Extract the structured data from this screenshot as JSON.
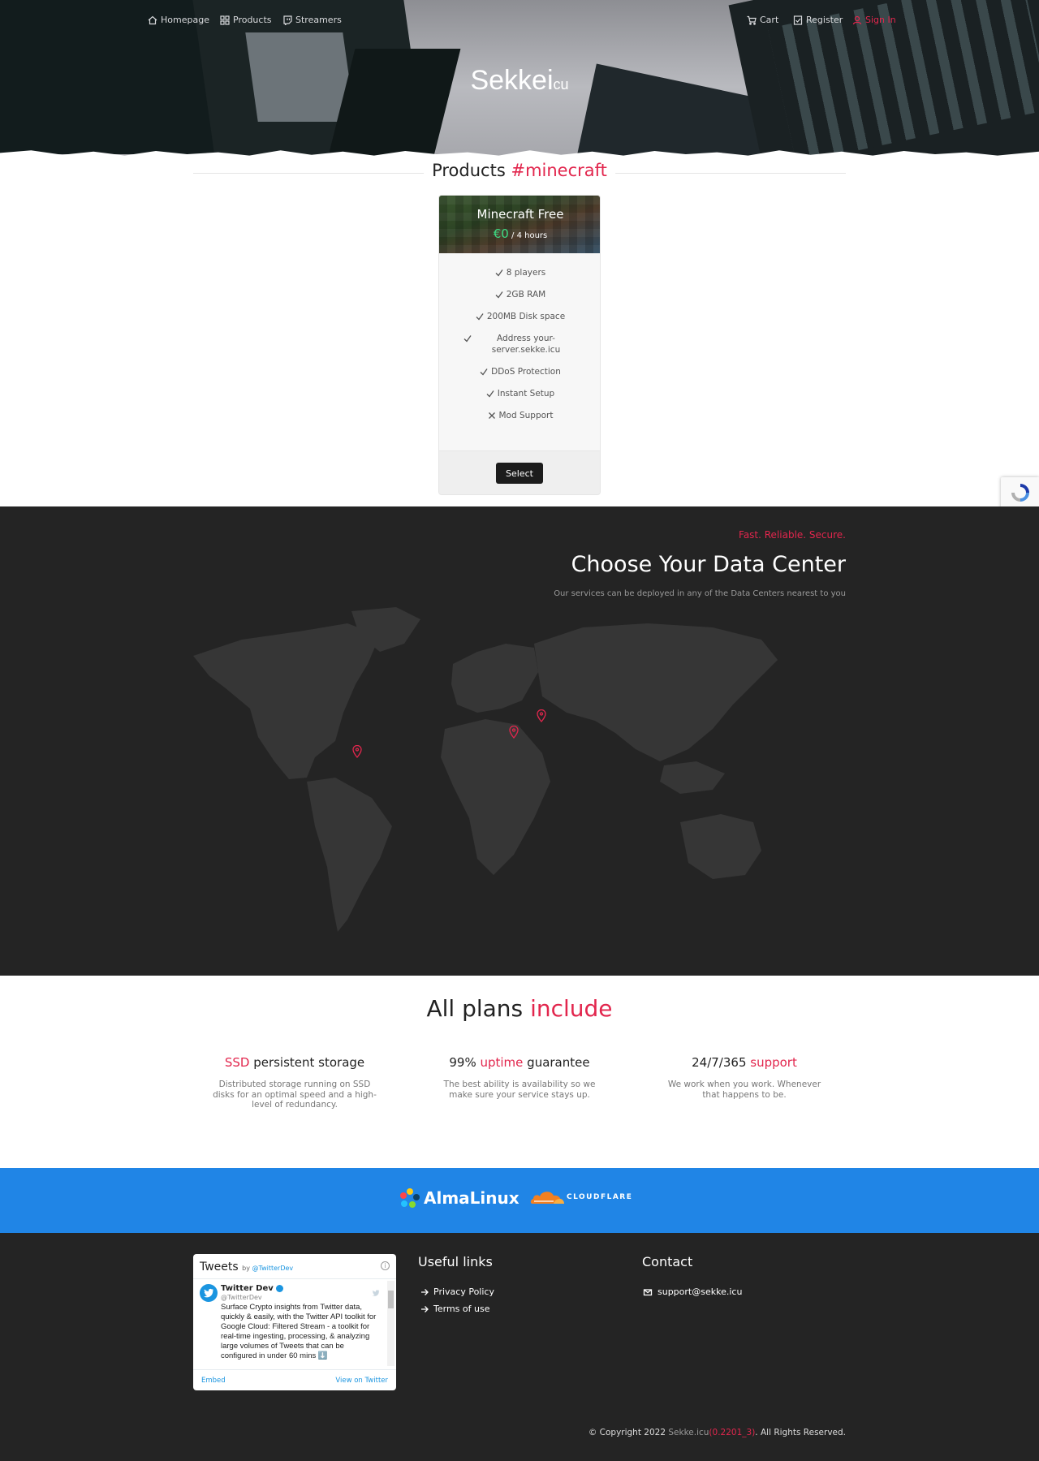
{
  "nav": {
    "items": [
      {
        "label": "Homepage",
        "icon": "home-icon"
      },
      {
        "label": "Products",
        "icon": "grid-icon"
      },
      {
        "label": "Streamers",
        "icon": "twitch-icon"
      }
    ],
    "right": [
      {
        "label": "Cart",
        "icon": "cart-icon"
      },
      {
        "label": "Register",
        "icon": "register-icon"
      },
      {
        "label": "Sign In",
        "icon": "user-icon"
      }
    ]
  },
  "brand": {
    "main": "Sekkei",
    "suffix": "cu"
  },
  "products": {
    "heading": "Products",
    "tag": "#minecraft",
    "card": {
      "title": "Minecraft Free",
      "price": "€0",
      "period": "/ 4 hours",
      "features": [
        {
          "label": "8 players",
          "included": true
        },
        {
          "label": "2GB RAM",
          "included": true
        },
        {
          "label": "200MB Disk space",
          "included": true
        },
        {
          "label": "Address your-server.sekke.icu",
          "included": true
        },
        {
          "label": "DDoS Protection",
          "included": true
        },
        {
          "label": "Instant Setup",
          "included": true
        },
        {
          "label": "Mod Support",
          "included": false
        }
      ],
      "button": "Select"
    }
  },
  "datacenter": {
    "kicker": "Fast. Reliable. Secure.",
    "title": "Choose Your Data Center",
    "subtitle": "Our services can be deployed in any of the Data Centers nearest to you"
  },
  "plans": {
    "title": "All plans",
    "title_accent": "include",
    "features": [
      {
        "pre": "SSD",
        "post": " persistent storage",
        "desc": "Distributed storage running on SSD disks for an optimal speed and a high-level of redundancy."
      },
      {
        "pre": "99% ",
        "accent": "uptime",
        "post": " guarantee",
        "desc": "The best ability is availability so we make sure your service stays up."
      },
      {
        "pre": "24/7/365 ",
        "accent": "support",
        "post": "",
        "desc": "We work when you work. Whenever that happens to be."
      }
    ]
  },
  "sponsors": {
    "alma": "AlmaLinux",
    "cloudflare": "CLOUDFLARE"
  },
  "footer": {
    "twitter": {
      "title": "Tweets",
      "by": "by",
      "handle_link": "@TwitterDev",
      "name": "Twitter Dev",
      "user": "@TwitterDev",
      "text": "Surface Crypto insights from Twitter data, quickly & easily, with the Twitter API toolkit for Google Cloud: Filtered Stream - a toolkit for real-time ingesting, processing, & analyzing large volumes of Tweets that can be configured in under 60 mins ⬇️",
      "embed": "Embed",
      "view": "View on Twitter"
    },
    "links_title": "Useful links",
    "links": [
      "Privacy Policy",
      "Terms of use"
    ],
    "contact_title": "Contact",
    "email": "support@sekke.icu",
    "copyright_pre": "© Copyright 2022 ",
    "copyright_site": "Sekke.icu",
    "copyright_ver": "(0.2201_3)",
    "copyright_post": ". All Rights Reserved."
  },
  "colors": {
    "accent": "#e2264d",
    "sponsor_bg": "#2085e6",
    "dark_bg": "#242424",
    "price": "#3ddc84"
  }
}
